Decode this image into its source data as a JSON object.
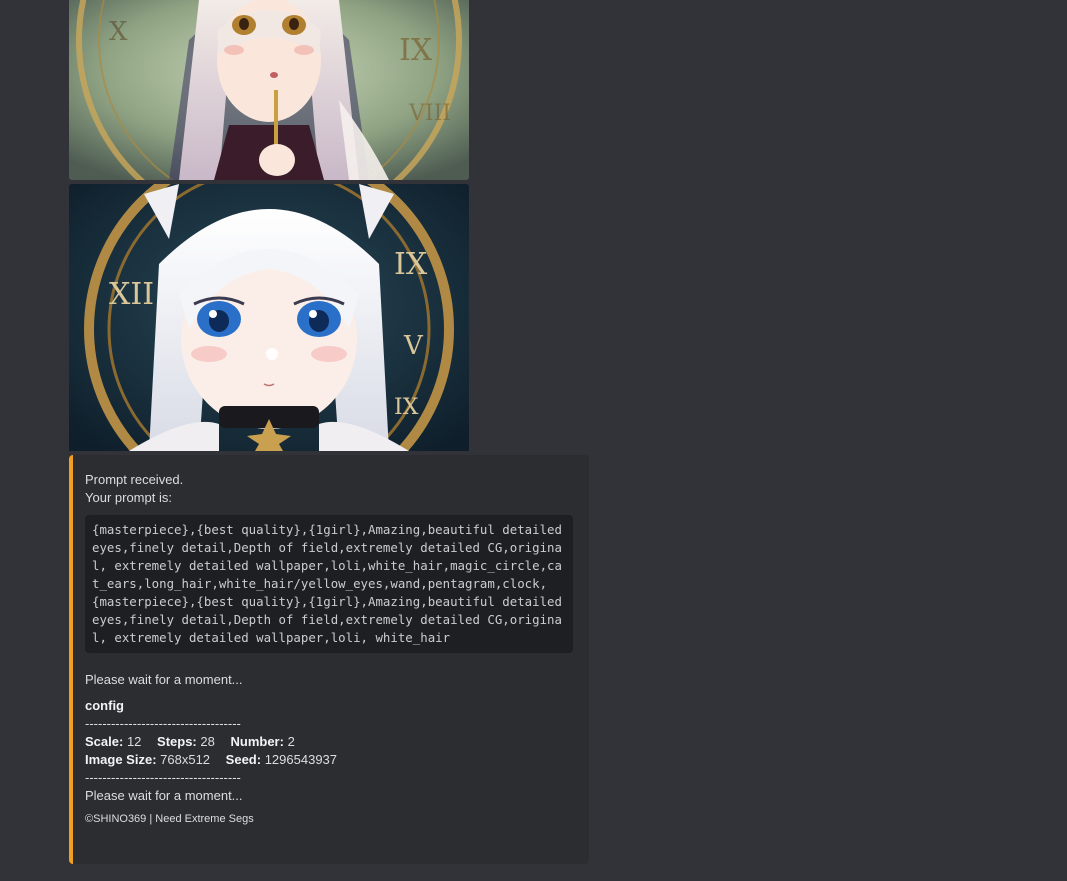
{
  "images": [
    {
      "name": "generated-image-1",
      "alt": "anime girl with clock background"
    },
    {
      "name": "generated-image-2",
      "alt": "anime girl with cat ears and clock"
    }
  ],
  "embed": {
    "accent_color": "#f0a020",
    "received": "Prompt received.",
    "your_prompt": "Your prompt is:",
    "prompt": "{masterpiece},{best quality},{1girl},Amazing,beautiful detailed eyes,finely detail,Depth of field,extremely detailed CG,original, extremely detailed wallpaper,loli,white_hair,magic_circle,cat_ears,long_hair,white_hair/yellow_eyes,wand,pentagram,clock, {masterpiece},{best quality},{1girl},Amazing,beautiful detailed eyes,finely detail,Depth of field,extremely detailed CG,original, extremely detailed wallpaper,loli, white_hair",
    "wait1": "Please wait for a moment...",
    "config_title": "config",
    "dashes": "------------------------------------",
    "scale_label": "Scale:",
    "scale_value": "12",
    "steps_label": "Steps:",
    "steps_value": "28",
    "number_label": "Number:",
    "number_value": "2",
    "size_label": "Image Size:",
    "size_value": "768x512",
    "seed_label": "Seed:",
    "seed_value": "1296543937",
    "wait2": "Please wait for a moment...",
    "footer": "©SHINO369 | Need Extreme Segs"
  }
}
